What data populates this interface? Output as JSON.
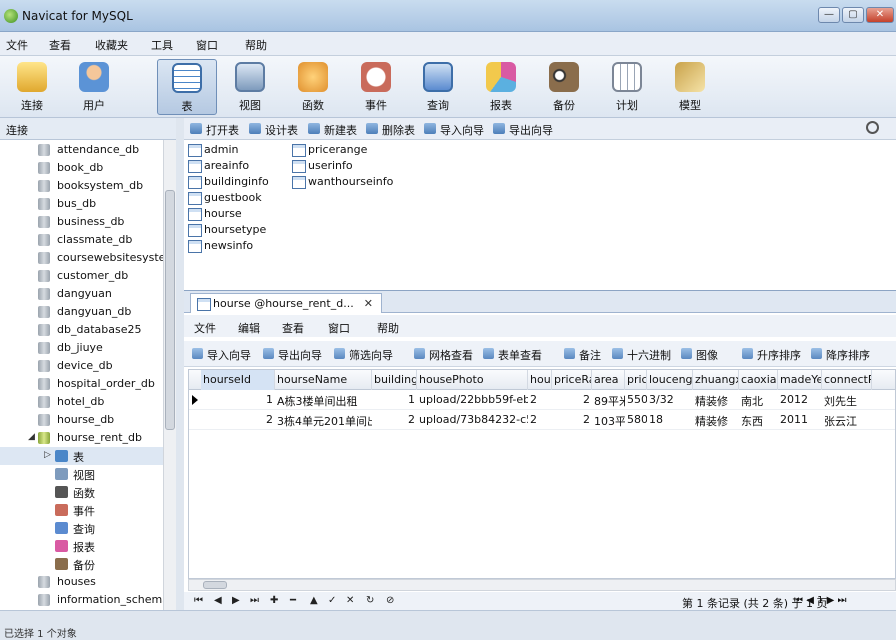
{
  "window": {
    "title": "Navicat for MySQL"
  },
  "menu": [
    "文件",
    "查看",
    "收藏夹",
    "工具",
    "窗口",
    "帮助"
  ],
  "toolbar": [
    {
      "label": "连接",
      "icon": "connection-icon",
      "color": "#f2c94c"
    },
    {
      "label": "用户",
      "icon": "user-icon",
      "color": "#6fa8dc"
    },
    {
      "label": "表",
      "icon": "table-icon",
      "color": "#4a86c8"
    },
    {
      "label": "视图",
      "icon": "view-icon",
      "color": "#7e9bbd"
    },
    {
      "label": "函数",
      "icon": "function-icon",
      "color": "#e0902e"
    },
    {
      "label": "事件",
      "icon": "event-icon",
      "color": "#c96b5b"
    },
    {
      "label": "查询",
      "icon": "query-icon",
      "color": "#5b8bd0"
    },
    {
      "label": "报表",
      "icon": "report-icon",
      "color": "#d95aa3"
    },
    {
      "label": "备份",
      "icon": "backup-icon",
      "color": "#8a6d4c"
    },
    {
      "label": "计划",
      "icon": "schedule-icon",
      "color": "#9aa5b5"
    },
    {
      "label": "模型",
      "icon": "model-icon",
      "color": "#c9a24a"
    }
  ],
  "left": {
    "header": "连接",
    "databases": [
      "attendance_db",
      "book_db",
      "booksystem_db",
      "bus_db",
      "business_db",
      "classmate_db",
      "coursewebsitesystem",
      "customer_db",
      "dangyuan",
      "dangyuan_db",
      "db_database25",
      "db_jiuye",
      "device_db",
      "hospital_order_db",
      "hotel_db",
      "hourse_db",
      "hourse_rent_db"
    ],
    "children": [
      "表",
      "视图",
      "函数",
      "事件",
      "查询",
      "报表",
      "备份"
    ],
    "after": [
      "houses",
      "information_schema"
    ]
  },
  "objtoolbar": [
    "打开表",
    "设计表",
    "新建表",
    "删除表",
    "导入向导",
    "导出向导"
  ],
  "tables": {
    "col1": [
      "admin",
      "areainfo",
      "buildinginfo",
      "guestbook",
      "hourse",
      "hoursetype",
      "newsinfo"
    ],
    "col2": [
      "pricerange",
      "userinfo",
      "wanthourseinfo"
    ]
  },
  "inner": {
    "tab": "hourse @hourse_rent_d...",
    "tab_close": "✕",
    "menu": [
      "文件",
      "编辑",
      "查看",
      "窗口",
      "帮助"
    ],
    "toolbar": [
      "导入向导",
      "导出向导",
      "筛选向导",
      "网格查看",
      "表单查看",
      "备注",
      "十六进制",
      "图像",
      "升序排序",
      "降序排序"
    ],
    "columns": [
      "hourseId",
      "hourseName",
      "building",
      "housePhoto",
      "hou",
      "priceRa",
      "area",
      "pric",
      "louceng",
      "zhuangxi",
      "caoxian",
      "madeYea",
      "connectP"
    ],
    "rows": [
      [
        "1",
        "A栋3楼单间出租",
        "1",
        "upload/22bbb59f-eb",
        "2",
        "2",
        "89平米",
        "550",
        "3/32",
        "精装修",
        "南北",
        "2012",
        "刘先生"
      ],
      [
        "2",
        "3栋4单元201单间出",
        "2",
        "upload/73b84232-c5",
        "2",
        "2",
        "103平米",
        "580",
        "18",
        "精装修",
        "东西",
        "2011",
        "张云江"
      ]
    ],
    "record_info": "第 1 条记录 (共 2 条) 于 1 页",
    "page": "1"
  },
  "status": "已选择 1 个对象"
}
